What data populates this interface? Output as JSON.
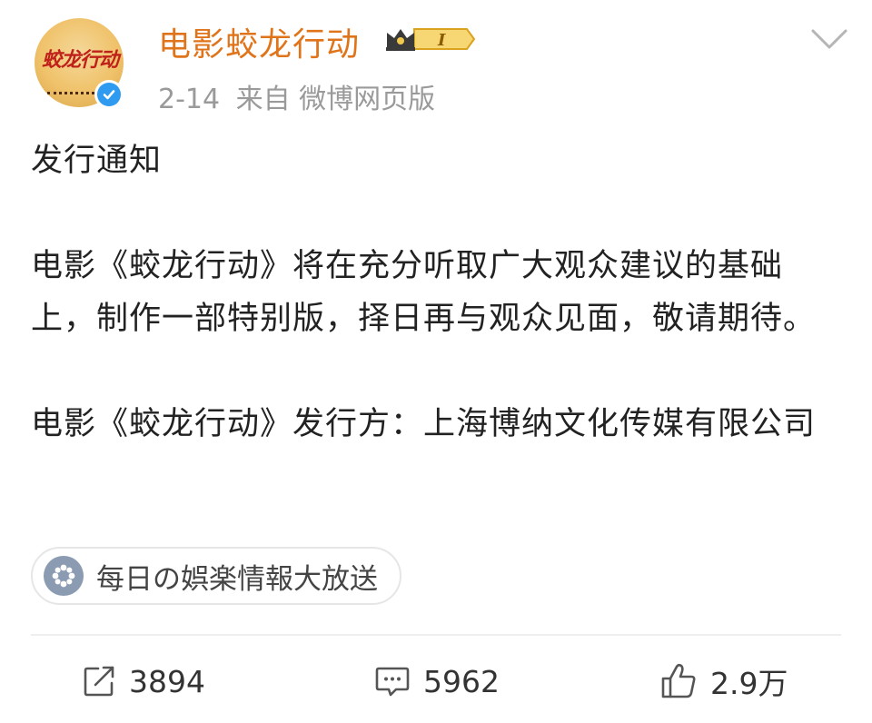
{
  "header": {
    "avatar_logo_text": "蛟龙行动",
    "account_name": "电影蛟龙行动",
    "badge_level": "I",
    "date": "2-14",
    "source": "来自 微博网页版"
  },
  "content": {
    "paragraphs": [
      "发行通知",
      "电影《蛟龙行动》将在充分听取广大观众建议的基础上，制作一部特别版，择日再与观众见面，敬请期待。",
      "电影《蛟龙行动》发行方：上海博纳文化传媒有限公司"
    ]
  },
  "topic": {
    "label": "每日の娯楽情報大放送"
  },
  "actions": {
    "repost_count": "3894",
    "comment_count": "5962",
    "like_count": "2.9万"
  },
  "colors": {
    "account_name": "#e0741a",
    "meta": "#9a9a9a",
    "verified": "#2f9bf0",
    "badge_gold": "#f2c94c"
  },
  "icons": [
    "verified-icon",
    "crown-badge-icon",
    "chevron-down-icon",
    "topic-icon",
    "repost-icon",
    "comment-icon",
    "like-icon"
  ]
}
